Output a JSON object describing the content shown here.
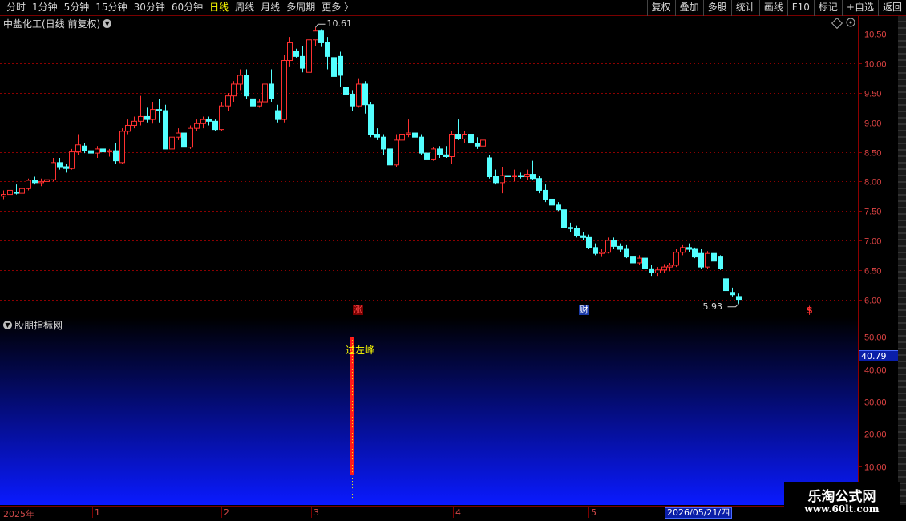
{
  "toolbar": {
    "periods": [
      "分时",
      "1分钟",
      "5分钟",
      "15分钟",
      "30分钟",
      "60分钟",
      "日线",
      "周线",
      "月线",
      "多周期",
      "更多 〉"
    ],
    "active_period": "日线",
    "buttons": [
      "复权",
      "叠加",
      "多股",
      "统计",
      "画线",
      "F10",
      "标记",
      "+自选",
      "返回"
    ]
  },
  "main_panel": {
    "title": "中盐化工(日线 前复权)",
    "title_icon": "chevron-down-icon",
    "price_axis": [
      "10.50",
      "10.00",
      "9.50",
      "9.00",
      "8.50",
      "8.00",
      "7.50",
      "7.00",
      "6.50",
      "6.00"
    ],
    "high_label": "10.61",
    "low_label": "5.93",
    "event_markers": [
      {
        "label": "涨",
        "color": "#ff4a4a",
        "bg": "#7a0000"
      },
      {
        "label": "财",
        "color": "#ffffff",
        "bg": "#1a3aa8"
      },
      {
        "label": "$",
        "color": "#ff3030",
        "bg": "#000000"
      }
    ]
  },
  "indicator_panel": {
    "title": "股朋指标网",
    "axis": [
      "50.00",
      "40.00",
      "30.00",
      "20.00",
      "10.00"
    ],
    "current_value": "40.79",
    "signal_label": "过左峰",
    "signal_value": 50
  },
  "date_axis": {
    "labels": [
      "2025年",
      "1",
      "2",
      "3",
      "4",
      "5"
    ],
    "cursor_date": "2026/05/21/四"
  },
  "watermark": {
    "title": "乐淘公式网",
    "url": "www.60lt.com"
  },
  "colors": {
    "up": "#ff3030",
    "down": "#54ffff",
    "grid": "#8b0000",
    "axis_text": "#e04444",
    "signal": "#ffff00"
  },
  "chart_data": {
    "type": "candlestick",
    "series": [
      {
        "o": 7.75,
        "h": 7.85,
        "l": 7.7,
        "c": 7.78
      },
      {
        "o": 7.78,
        "h": 7.9,
        "l": 7.72,
        "c": 7.85
      },
      {
        "o": 7.82,
        "h": 7.95,
        "l": 7.78,
        "c": 7.8
      },
      {
        "o": 7.8,
        "h": 7.92,
        "l": 7.76,
        "c": 7.88
      },
      {
        "o": 7.88,
        "h": 8.05,
        "l": 7.85,
        "c": 8.02
      },
      {
        "o": 8.02,
        "h": 8.08,
        "l": 7.95,
        "c": 7.98
      },
      {
        "o": 7.98,
        "h": 8.05,
        "l": 7.92,
        "c": 8.0
      },
      {
        "o": 8.0,
        "h": 8.06,
        "l": 7.96,
        "c": 8.03
      },
      {
        "o": 8.03,
        "h": 8.4,
        "l": 8.0,
        "c": 8.32
      },
      {
        "o": 8.32,
        "h": 8.4,
        "l": 8.2,
        "c": 8.25
      },
      {
        "o": 8.25,
        "h": 8.3,
        "l": 8.15,
        "c": 8.22
      },
      {
        "o": 8.22,
        "h": 8.55,
        "l": 8.2,
        "c": 8.5
      },
      {
        "o": 8.5,
        "h": 8.8,
        "l": 8.45,
        "c": 8.62
      },
      {
        "o": 8.6,
        "h": 8.65,
        "l": 8.48,
        "c": 8.52
      },
      {
        "o": 8.52,
        "h": 8.58,
        "l": 8.45,
        "c": 8.48
      },
      {
        "o": 8.48,
        "h": 8.6,
        "l": 8.4,
        "c": 8.55
      },
      {
        "o": 8.55,
        "h": 8.65,
        "l": 8.45,
        "c": 8.5
      },
      {
        "o": 8.5,
        "h": 8.55,
        "l": 8.42,
        "c": 8.52
      },
      {
        "o": 8.52,
        "h": 8.65,
        "l": 8.3,
        "c": 8.35
      },
      {
        "o": 8.32,
        "h": 8.9,
        "l": 8.3,
        "c": 8.85
      },
      {
        "o": 8.85,
        "h": 9.05,
        "l": 8.8,
        "c": 8.95
      },
      {
        "o": 8.95,
        "h": 9.1,
        "l": 8.9,
        "c": 9.02
      },
      {
        "o": 9.02,
        "h": 9.45,
        "l": 8.95,
        "c": 9.1
      },
      {
        "o": 9.1,
        "h": 9.25,
        "l": 9.0,
        "c": 9.05
      },
      {
        "o": 9.05,
        "h": 9.35,
        "l": 8.98,
        "c": 9.22
      },
      {
        "o": 9.22,
        "h": 9.4,
        "l": 9.0,
        "c": 9.2
      },
      {
        "o": 9.2,
        "h": 9.3,
        "l": 8.55,
        "c": 8.55
      },
      {
        "o": 8.55,
        "h": 8.8,
        "l": 8.5,
        "c": 8.75
      },
      {
        "o": 8.75,
        "h": 8.9,
        "l": 8.7,
        "c": 8.82
      },
      {
        "o": 8.82,
        "h": 8.9,
        "l": 8.55,
        "c": 8.58
      },
      {
        "o": 8.58,
        "h": 8.95,
        "l": 8.55,
        "c": 8.9
      },
      {
        "o": 8.9,
        "h": 9.05,
        "l": 8.85,
        "c": 8.98
      },
      {
        "o": 8.98,
        "h": 9.1,
        "l": 8.9,
        "c": 9.05
      },
      {
        "o": 9.05,
        "h": 9.1,
        "l": 8.95,
        "c": 9.02
      },
      {
        "o": 9.02,
        "h": 9.05,
        "l": 8.85,
        "c": 8.88
      },
      {
        "o": 8.88,
        "h": 9.35,
        "l": 8.85,
        "c": 9.28
      },
      {
        "o": 9.28,
        "h": 9.5,
        "l": 9.2,
        "c": 9.45
      },
      {
        "o": 9.45,
        "h": 9.7,
        "l": 9.35,
        "c": 9.65
      },
      {
        "o": 9.65,
        "h": 9.9,
        "l": 9.55,
        "c": 9.8
      },
      {
        "o": 9.8,
        "h": 9.9,
        "l": 9.4,
        "c": 9.45
      },
      {
        "o": 9.4,
        "h": 9.45,
        "l": 9.22,
        "c": 9.28
      },
      {
        "o": 9.28,
        "h": 9.4,
        "l": 9.25,
        "c": 9.35
      },
      {
        "o": 9.35,
        "h": 9.75,
        "l": 9.3,
        "c": 9.65
      },
      {
        "o": 9.65,
        "h": 9.9,
        "l": 9.35,
        "c": 9.4
      },
      {
        "o": 9.2,
        "h": 9.3,
        "l": 9.0,
        "c": 9.05
      },
      {
        "o": 9.05,
        "h": 10.15,
        "l": 9.0,
        "c": 10.05
      },
      {
        "o": 10.05,
        "h": 10.45,
        "l": 9.95,
        "c": 10.35
      },
      {
        "o": 10.2,
        "h": 10.25,
        "l": 10.1,
        "c": 10.12
      },
      {
        "o": 10.12,
        "h": 10.3,
        "l": 9.85,
        "c": 9.92
      },
      {
        "o": 9.85,
        "h": 10.5,
        "l": 9.8,
        "c": 10.4
      },
      {
        "o": 10.4,
        "h": 10.61,
        "l": 10.3,
        "c": 10.55
      },
      {
        "o": 10.55,
        "h": 10.58,
        "l": 10.28,
        "c": 10.35
      },
      {
        "o": 10.35,
        "h": 10.45,
        "l": 9.9,
        "c": 10.12
      },
      {
        "o": 10.1,
        "h": 10.2,
        "l": 9.7,
        "c": 9.78
      },
      {
        "o": 10.12,
        "h": 10.2,
        "l": 9.6,
        "c": 9.8
      },
      {
        "o": 9.6,
        "h": 9.65,
        "l": 9.2,
        "c": 9.48
      },
      {
        "o": 9.48,
        "h": 9.55,
        "l": 9.2,
        "c": 9.28
      },
      {
        "o": 9.28,
        "h": 9.75,
        "l": 9.25,
        "c": 9.65
      },
      {
        "o": 9.65,
        "h": 9.7,
        "l": 9.15,
        "c": 9.3
      },
      {
        "o": 9.3,
        "h": 9.35,
        "l": 8.75,
        "c": 8.8
      },
      {
        "o": 8.8,
        "h": 8.9,
        "l": 8.7,
        "c": 8.75
      },
      {
        "o": 8.75,
        "h": 8.8,
        "l": 8.45,
        "c": 8.55
      },
      {
        "o": 8.55,
        "h": 8.6,
        "l": 8.1,
        "c": 8.28
      },
      {
        "o": 8.28,
        "h": 8.8,
        "l": 8.25,
        "c": 8.7
      },
      {
        "o": 8.7,
        "h": 8.85,
        "l": 8.6,
        "c": 8.8
      },
      {
        "o": 8.8,
        "h": 9.05,
        "l": 8.75,
        "c": 8.82
      },
      {
        "o": 8.82,
        "h": 8.85,
        "l": 8.7,
        "c": 8.75
      },
      {
        "o": 8.75,
        "h": 8.8,
        "l": 8.45,
        "c": 8.48
      },
      {
        "o": 8.48,
        "h": 8.6,
        "l": 8.35,
        "c": 8.38
      },
      {
        "o": 8.38,
        "h": 8.58,
        "l": 8.35,
        "c": 8.55
      },
      {
        "o": 8.55,
        "h": 8.6,
        "l": 8.4,
        "c": 8.45
      },
      {
        "o": 8.45,
        "h": 8.6,
        "l": 8.4,
        "c": 8.42
      },
      {
        "o": 8.42,
        "h": 8.85,
        "l": 8.3,
        "c": 8.8
      },
      {
        "o": 8.8,
        "h": 9.05,
        "l": 8.7,
        "c": 8.72
      },
      {
        "o": 8.72,
        "h": 8.85,
        "l": 8.65,
        "c": 8.8
      },
      {
        "o": 8.8,
        "h": 8.85,
        "l": 8.6,
        "c": 8.65
      },
      {
        "o": 8.65,
        "h": 8.75,
        "l": 8.55,
        "c": 8.6
      },
      {
        "o": 8.6,
        "h": 8.75,
        "l": 8.55,
        "c": 8.7
      },
      {
        "o": 8.4,
        "h": 8.45,
        "l": 8.05,
        "c": 8.08
      },
      {
        "o": 8.08,
        "h": 8.2,
        "l": 7.95,
        "c": 7.98
      },
      {
        "o": 7.98,
        "h": 8.25,
        "l": 7.8,
        "c": 8.1
      },
      {
        "o": 8.1,
        "h": 8.25,
        "l": 8.05,
        "c": 8.08
      },
      {
        "o": 8.08,
        "h": 8.2,
        "l": 8.0,
        "c": 8.1
      },
      {
        "o": 8.1,
        "h": 8.15,
        "l": 8.05,
        "c": 8.08
      },
      {
        "o": 8.08,
        "h": 8.2,
        "l": 8.02,
        "c": 8.12
      },
      {
        "o": 8.12,
        "h": 8.35,
        "l": 8.02,
        "c": 8.05
      },
      {
        "o": 8.05,
        "h": 8.1,
        "l": 7.8,
        "c": 7.85
      },
      {
        "o": 7.85,
        "h": 7.95,
        "l": 7.65,
        "c": 7.7
      },
      {
        "o": 7.7,
        "h": 7.75,
        "l": 7.55,
        "c": 7.6
      },
      {
        "o": 7.6,
        "h": 7.65,
        "l": 7.5,
        "c": 7.52
      },
      {
        "o": 7.52,
        "h": 7.55,
        "l": 7.2,
        "c": 7.22
      },
      {
        "o": 7.22,
        "h": 7.3,
        "l": 7.15,
        "c": 7.2
      },
      {
        "o": 7.2,
        "h": 7.25,
        "l": 7.05,
        "c": 7.08
      },
      {
        "o": 7.08,
        "h": 7.15,
        "l": 7.0,
        "c": 7.05
      },
      {
        "o": 7.05,
        "h": 7.1,
        "l": 6.85,
        "c": 6.88
      },
      {
        "o": 6.88,
        "h": 6.95,
        "l": 6.75,
        "c": 6.78
      },
      {
        "o": 6.78,
        "h": 6.85,
        "l": 6.72,
        "c": 6.8
      },
      {
        "o": 6.8,
        "h": 7.05,
        "l": 6.78,
        "c": 7.0
      },
      {
        "o": 7.0,
        "h": 7.05,
        "l": 6.85,
        "c": 6.9
      },
      {
        "o": 6.9,
        "h": 6.95,
        "l": 6.8,
        "c": 6.85
      },
      {
        "o": 6.85,
        "h": 6.92,
        "l": 6.7,
        "c": 6.72
      },
      {
        "o": 6.72,
        "h": 6.78,
        "l": 6.6,
        "c": 6.62
      },
      {
        "o": 6.62,
        "h": 6.75,
        "l": 6.58,
        "c": 6.7
      },
      {
        "o": 6.7,
        "h": 6.75,
        "l": 6.5,
        "c": 6.52
      },
      {
        "o": 6.52,
        "h": 6.58,
        "l": 6.4,
        "c": 6.45
      },
      {
        "o": 6.45,
        "h": 6.55,
        "l": 6.4,
        "c": 6.5
      },
      {
        "o": 6.5,
        "h": 6.6,
        "l": 6.45,
        "c": 6.55
      },
      {
        "o": 6.55,
        "h": 6.62,
        "l": 6.48,
        "c": 6.58
      },
      {
        "o": 6.58,
        "h": 6.85,
        "l": 6.55,
        "c": 6.8
      },
      {
        "o": 6.8,
        "h": 6.92,
        "l": 6.75,
        "c": 6.88
      },
      {
        "o": 6.88,
        "h": 6.95,
        "l": 6.8,
        "c": 6.85
      },
      {
        "o": 6.85,
        "h": 6.88,
        "l": 6.7,
        "c": 6.72
      },
      {
        "o": 6.78,
        "h": 6.85,
        "l": 6.52,
        "c": 6.55
      },
      {
        "o": 6.55,
        "h": 6.82,
        "l": 6.52,
        "c": 6.78
      },
      {
        "o": 6.78,
        "h": 6.9,
        "l": 6.6,
        "c": 6.65
      },
      {
        "o": 6.72,
        "h": 6.75,
        "l": 6.5,
        "c": 6.52
      },
      {
        "o": 6.35,
        "h": 6.4,
        "l": 6.12,
        "c": 6.15
      },
      {
        "o": 6.12,
        "h": 6.2,
        "l": 6.05,
        "c": 6.08
      },
      {
        "o": 6.05,
        "h": 6.1,
        "l": 5.93,
        "c": 6.0
      }
    ],
    "ylim": [
      5.75,
      10.75
    ],
    "indicator": {
      "type": "bar",
      "ylim": [
        0,
        55
      ],
      "signal_index": 56,
      "value": 50
    }
  }
}
